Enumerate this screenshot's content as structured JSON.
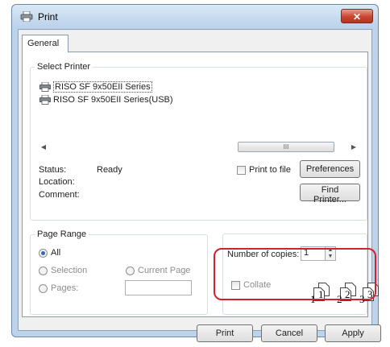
{
  "window": {
    "title": "Print",
    "close_glyph": "✕"
  },
  "tabs": [
    {
      "label": "General"
    }
  ],
  "select_printer": {
    "legend": "Select Printer",
    "printers": [
      {
        "name": "RISO SF 9x50EII Series",
        "selected": true
      },
      {
        "name": "RISO SF 9x50EII Series(USB)",
        "selected": false
      }
    ],
    "scrollbar_thumb_glyph": "III"
  },
  "status": {
    "status_label": "Status:",
    "status_value": "Ready",
    "location_label": "Location:",
    "comment_label": "Comment:",
    "print_to_file_label": "Print to file",
    "preferences_button": "Preferences",
    "find_printer_button": "Find Printer..."
  },
  "page_range": {
    "legend": "Page Range",
    "all_label": "All",
    "selection_label": "Selection",
    "current_page_label": "Current Page",
    "pages_label": "Pages:",
    "pages_value": ""
  },
  "copies": {
    "number_label": "Number of copies:",
    "number_value": "1",
    "collate_label": "Collate",
    "collate_pages": [
      "1",
      "1",
      "2",
      "2",
      "3",
      "3"
    ]
  },
  "buttons": {
    "print": "Print",
    "cancel": "Cancel",
    "apply": "Apply"
  },
  "colors": {
    "highlight": "#d0222e",
    "close_button": "#c9452f",
    "frame": "#bcd3ea"
  }
}
